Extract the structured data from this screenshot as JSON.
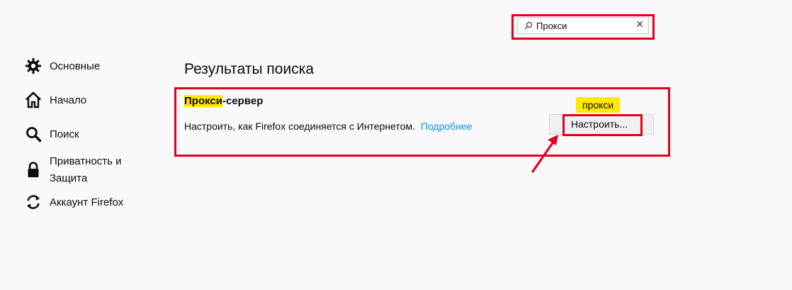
{
  "search": {
    "value": "Прокси",
    "placeholder": ""
  },
  "sidebar": {
    "items": [
      {
        "label": "Основные",
        "icon": "gear-icon"
      },
      {
        "label": "Начало",
        "icon": "home-icon"
      },
      {
        "label": "Поиск",
        "icon": "search-icon"
      },
      {
        "label": "Приватность и Защита",
        "icon": "lock-icon"
      },
      {
        "label": "Аккаунт Firefox",
        "icon": "sync-icon"
      }
    ]
  },
  "main": {
    "title": "Результаты поиска",
    "result": {
      "title_highlight": "Прокси",
      "title_rest": "-сервер",
      "description": "Настроить, как Firefox соединяется с Интернетом.",
      "learn_more": "Подробнее",
      "button_label": "Настроить...",
      "tooltip": "прокси"
    }
  },
  "colors": {
    "annotation": "#e2001a",
    "highlight": "#ffe900",
    "link": "#0a8dff"
  }
}
